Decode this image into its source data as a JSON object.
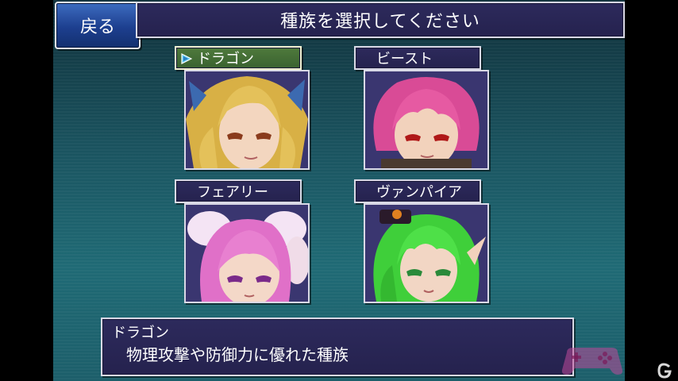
{
  "header": {
    "back_label": "戻る",
    "title": "種族を選択してください"
  },
  "races": [
    {
      "label": "ドラゴン",
      "selected": true,
      "hair_color": "#d8b045"
    },
    {
      "label": "ビースト",
      "selected": false,
      "hair_color": "#d94b96"
    },
    {
      "label": "フェアリー",
      "selected": false,
      "hair_color": "#e070c8"
    },
    {
      "label": "ヴァンパイア",
      "selected": false,
      "hair_color": "#3fcf3a"
    }
  ],
  "description": {
    "title": "ドラゴン",
    "text": "物理攻撃や防御力に優れた種族"
  },
  "colors": {
    "panel": "#2d2a5c",
    "selected_label": "#4f7a3c",
    "back_button": "#1d3f8f",
    "background": "#1a5460"
  }
}
